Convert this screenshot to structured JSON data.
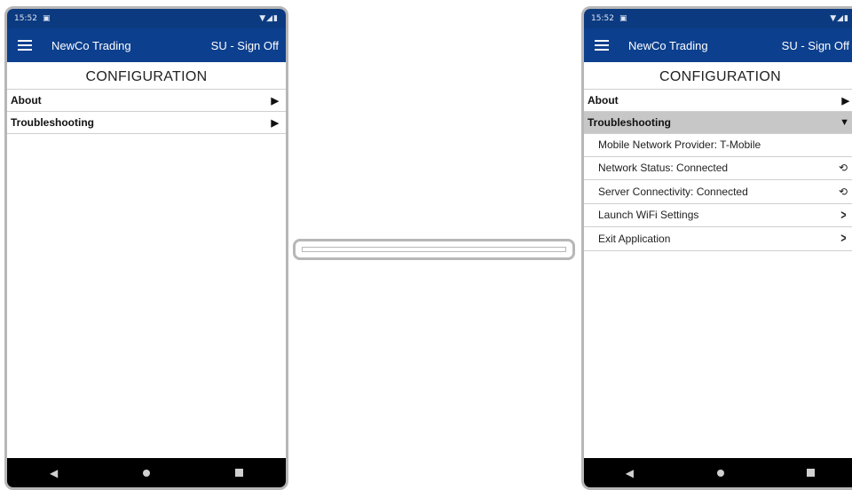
{
  "status_bar": {
    "time": "15:52",
    "sim_icon": "sim-card-icon",
    "signal_icons": "wifi-signal-battery-icons"
  },
  "app_bar": {
    "menu_icon": "hamburger-menu-icon",
    "title": "NewCo Trading",
    "sign_off": "SU - Sign Off"
  },
  "page_title": "CONFIGURATION",
  "left_screen": {
    "sections": [
      {
        "label": "About",
        "state": "collapsed"
      },
      {
        "label": "Troubleshooting",
        "state": "collapsed"
      }
    ]
  },
  "right_screen": {
    "sections": [
      {
        "label": "About",
        "state": "collapsed"
      },
      {
        "label": "Troubleshooting",
        "state": "expanded"
      }
    ],
    "troubleshooting_items": [
      {
        "label": "Mobile Network Provider: T-Mobile",
        "icon": ""
      },
      {
        "label": "Network Status: Connected",
        "icon": "refresh-icon"
      },
      {
        "label": "Server Connectivity: Connected",
        "icon": "refresh-icon"
      },
      {
        "label": "Launch WiFi Settings",
        "icon": "chevron-right-icon"
      },
      {
        "label": "Exit Application",
        "icon": "chevron-right-icon"
      }
    ]
  },
  "progress": {
    "fraction": 0
  },
  "nav_bar": {
    "back": "back-icon",
    "home": "home-icon",
    "recents": "recents-icon"
  },
  "colors": {
    "app_bar": "#0c3f8e",
    "status_bar": "#0b3a80",
    "expanded_section": "#c7c7c7",
    "nav_bar": "#000000"
  }
}
